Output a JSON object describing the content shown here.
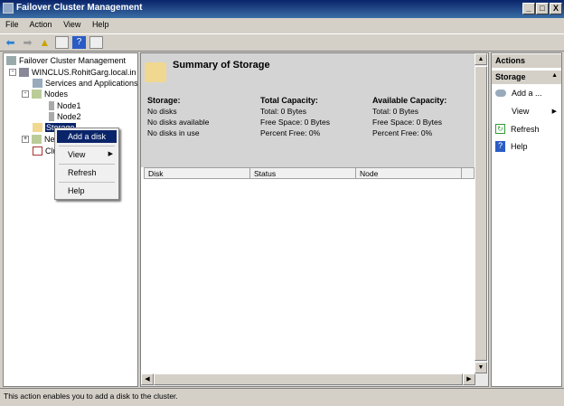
{
  "window": {
    "title": "Failover Cluster Management",
    "controls": [
      "_",
      "□",
      "X"
    ]
  },
  "menu": [
    "File",
    "Action",
    "View",
    "Help"
  ],
  "tree": {
    "root": "Failover Cluster Management",
    "cluster": "WINCLUS.RohitGarg.local.in",
    "services": "Services and Applications",
    "nodes": "Nodes",
    "node1": "Node1",
    "node2": "Node2",
    "storage": "Storage",
    "networks": "Networks",
    "events": "Cluster Events"
  },
  "context_menu": {
    "add_disk": "Add a disk",
    "view": "View",
    "refresh": "Refresh",
    "help": "Help"
  },
  "summary": {
    "title": "Summary of Storage",
    "storage": {
      "heading": "Storage:",
      "lines": [
        "No disks",
        "No disks available",
        "No disks in use"
      ]
    },
    "total": {
      "heading": "Total Capacity:",
      "lines": [
        "Total: 0 Bytes",
        "Free Space: 0 Bytes",
        "Percent Free: 0%"
      ]
    },
    "available": {
      "heading": "Available Capacity:",
      "lines": [
        "Total: 0 Bytes",
        "Free Space: 0 Bytes",
        "Percent Free: 0%"
      ]
    }
  },
  "columns": [
    "Disk",
    "Status",
    "Node"
  ],
  "actions": {
    "header": "Actions",
    "section": "Storage",
    "items": [
      "Add a ...",
      "View",
      "Refresh",
      "Help"
    ]
  },
  "status_bar": "This action enables you to add a disk to the cluster."
}
